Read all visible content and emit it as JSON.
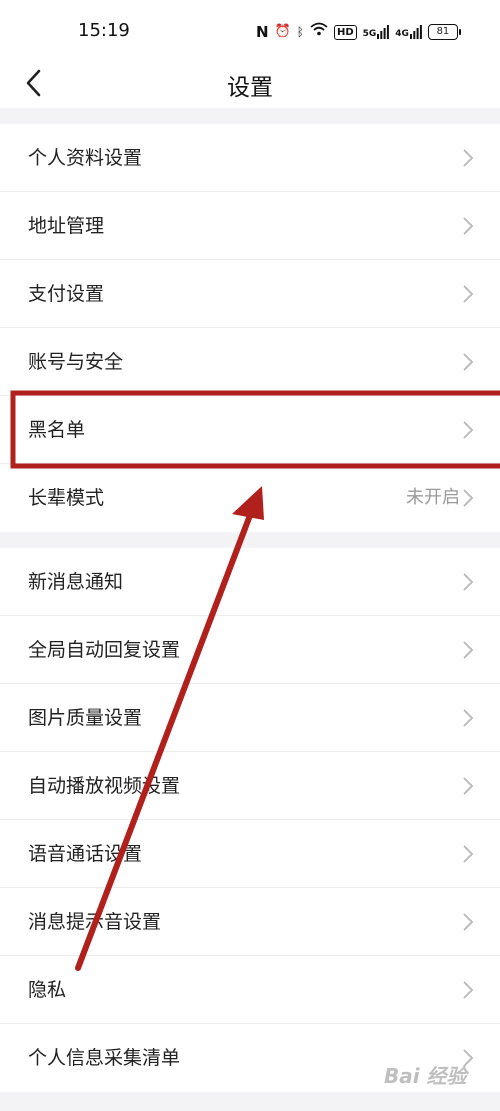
{
  "status_bar": {
    "time": "15:19",
    "icons": [
      "nfc-icon",
      "alarm-icon",
      "bluetooth-icon",
      "wifi-icon",
      "hd-icon",
      "signal-5g-icon",
      "signal-4g-icon"
    ],
    "hd_label": "HD",
    "net1": "5G",
    "net2": "4G",
    "battery": "81"
  },
  "nav": {
    "title": "设置"
  },
  "groups": [
    {
      "items": [
        {
          "label": "个人资料设置"
        },
        {
          "label": "地址管理"
        },
        {
          "label": "支付设置"
        },
        {
          "label": "账号与安全"
        },
        {
          "label": "黑名单"
        },
        {
          "label": "长辈模式",
          "value": "未开启"
        }
      ]
    },
    {
      "items": [
        {
          "label": "新消息通知"
        },
        {
          "label": "全局自动回复设置"
        },
        {
          "label": "图片质量设置"
        },
        {
          "label": "自动播放视频设置"
        },
        {
          "label": "语音通话设置"
        },
        {
          "label": "消息提示音设置"
        },
        {
          "label": "隐私"
        },
        {
          "label": "个人信息采集清单"
        }
      ]
    }
  ],
  "annotation": {
    "color": "#b0201c"
  },
  "watermark": {
    "text": "Bai 经验"
  }
}
